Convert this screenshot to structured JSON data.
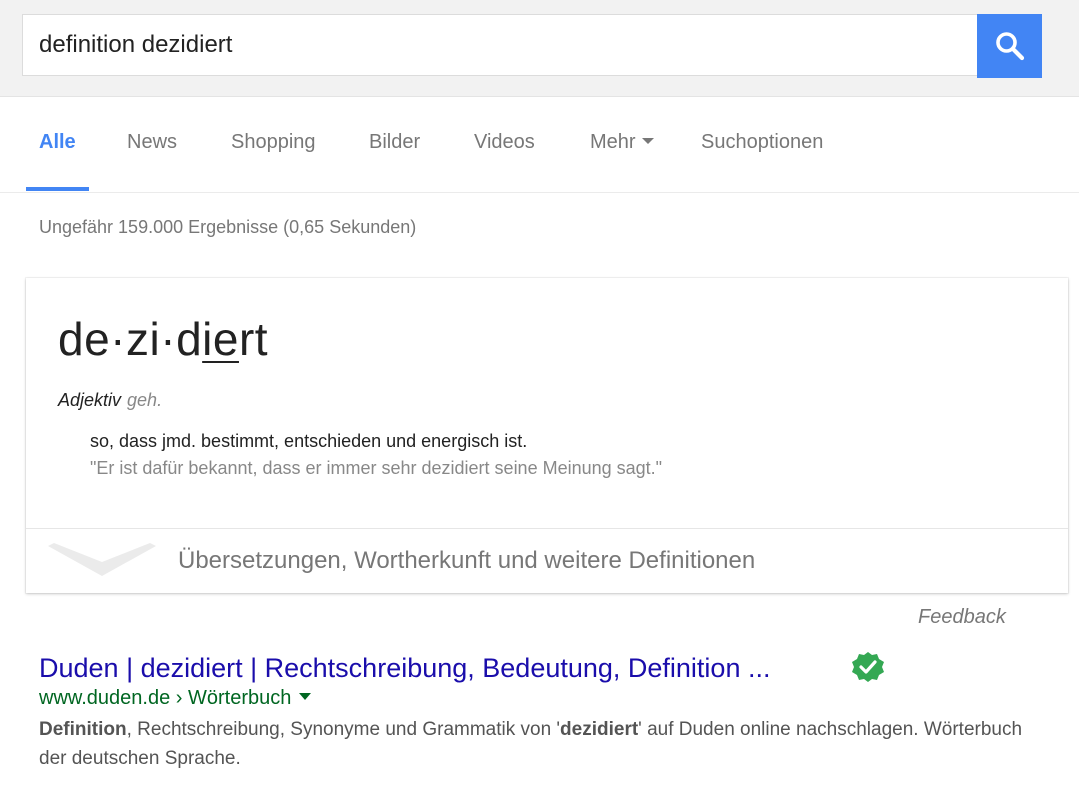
{
  "search": {
    "query": "definition dezidiert",
    "button_icon": "search-icon"
  },
  "tabs": [
    {
      "label": "Alle",
      "active": true
    },
    {
      "label": "News"
    },
    {
      "label": "Shopping"
    },
    {
      "label": "Bilder"
    },
    {
      "label": "Videos"
    },
    {
      "label": "Mehr"
    },
    {
      "label": "Suchoptionen"
    }
  ],
  "stats": "Ungefähr 159.000 Ergebnisse (0,65 Sekunden)",
  "dictionary": {
    "syllables": [
      "de",
      "zi",
      "d",
      "ie",
      "rt"
    ],
    "separator": "·",
    "word_class": "Adjektiv",
    "register": "geh.",
    "meaning": "so, dass jmd. bestimmt, entschieden und energisch ist.",
    "example": "\"Er ist dafür bekannt, dass er immer sehr dezidiert seine Meinung sagt.\"",
    "expand_label": "Übersetzungen, Wortherkunft und weitere Definitionen"
  },
  "feedback": "Feedback",
  "result": {
    "title": "Duden | dezidiert | Rechtschreibung, Bedeutung, Definition ...",
    "url_host": "www.duden.de",
    "url_sep": " › ",
    "url_path": "Wörterbuch",
    "snippet": {
      "b1": "Definition",
      "t1": ", Rechtschreibung, Synonyme und Grammatik von '",
      "b2": "dezidiert",
      "t2": "' auf Duden online nachschlagen. Wörterbuch der deutschen Sprache."
    }
  },
  "colors": {
    "accent": "#4285f4",
    "link": "#1a0dab",
    "url": "#006621",
    "verified": "#34a853"
  }
}
